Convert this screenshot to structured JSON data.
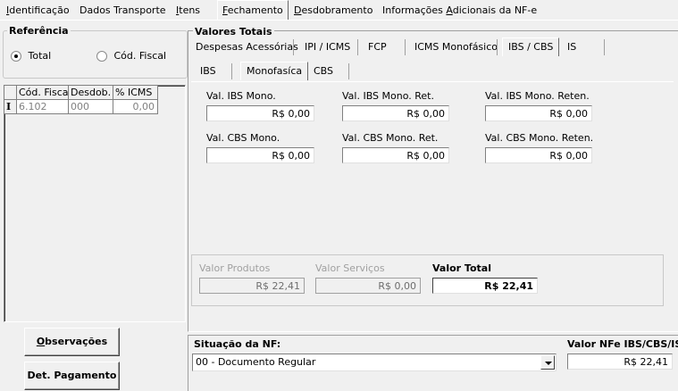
{
  "top_tabs": [
    {
      "pre": "",
      "u": "I",
      "post": "dentificação"
    },
    {
      "pre": "Dados Transporte",
      "u": "",
      "post": ""
    },
    {
      "pre": "",
      "u": "I",
      "post": "tens"
    },
    {
      "pre": "",
      "u": "F",
      "post": "echamento"
    },
    {
      "pre": "",
      "u": "D",
      "post": "esdobramento"
    },
    {
      "pre": "Informações ",
      "u": "A",
      "post": "dicionais da NF-e"
    }
  ],
  "referencia": {
    "title": "Referência",
    "option_total": "Total",
    "option_cod_fiscal": "Cód. Fiscal"
  },
  "grid": {
    "headers": [
      "Cód. Fiscal",
      "Desdob.",
      "% ICMS"
    ],
    "rows": [
      [
        "6.102",
        "000",
        "0,00"
      ]
    ]
  },
  "valores_totais": {
    "title": "Valores Totais",
    "tabs": [
      "Despesas Acessórias",
      "IPI / ICMS",
      "FCP",
      "ICMS Monofásico",
      "IBS / CBS",
      "IS"
    ],
    "subtabs": [
      "IBS",
      "Monofasíca",
      "CBS"
    ],
    "fields": [
      {
        "label": "Val. IBS Mono.",
        "value": "R$ 0,00"
      },
      {
        "label": "Val. IBS Mono. Ret.",
        "value": "R$ 0,00"
      },
      {
        "label": "Val. IBS Mono. Reten.",
        "value": "R$ 0,00"
      },
      {
        "label": "Val. CBS Mono.",
        "value": "R$ 0,00"
      },
      {
        "label": "Val. CBS Mono. Ret.",
        "value": "R$ 0,00"
      },
      {
        "label": "Val. CBS Mono. Reten.",
        "value": "R$ 0,00"
      }
    ],
    "valor_produtos_label": "Valor Produtos",
    "valor_produtos": "R$ 22,41",
    "valor_servicos_label": "Valor Serviços",
    "valor_servicos": "R$ 0,00",
    "valor_total_label": "Valor Total",
    "valor_total": "R$ 22,41"
  },
  "buttons": {
    "observacoes_u": "O",
    "observacoes_rest": "bservações",
    "det_pagamento": "Det. Pagamento"
  },
  "situacao": {
    "label": "Situação da NF:",
    "value": "00 - Documento Regular",
    "valor_nfe_label": "Valor NFe IBS/CBS/IS",
    "valor_nfe": "R$ 22,41"
  }
}
